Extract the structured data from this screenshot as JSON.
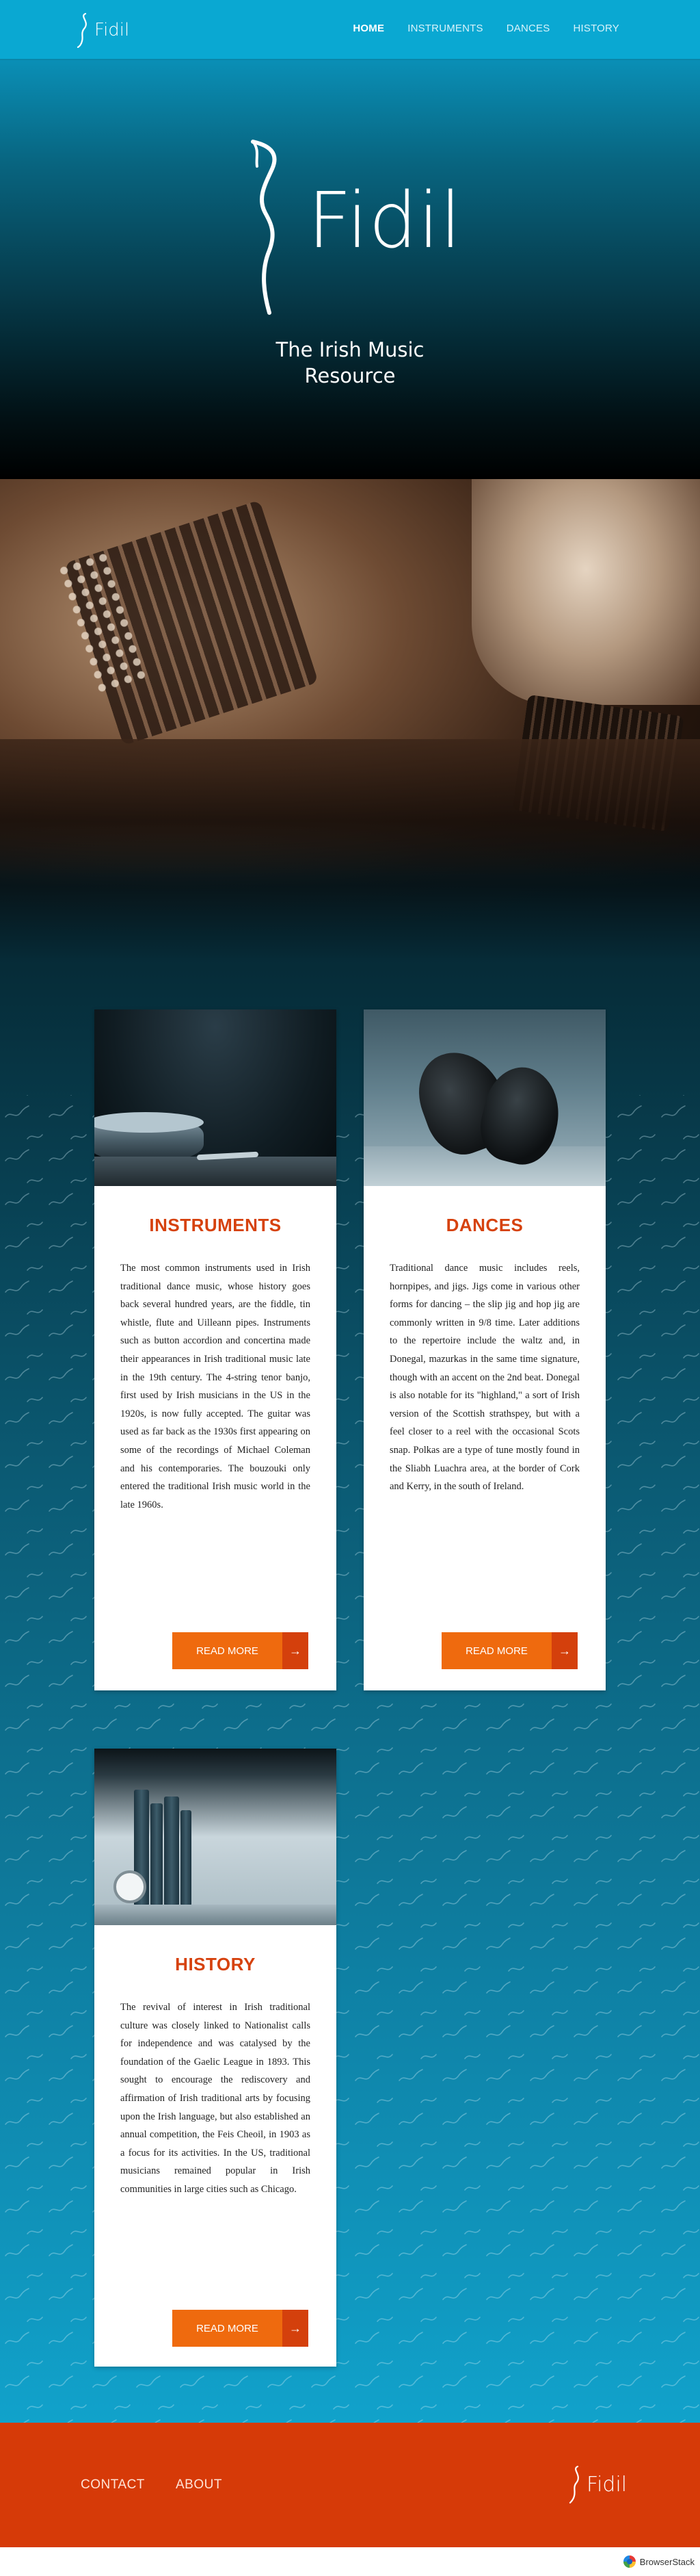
{
  "header": {
    "logo_text": "Fidil",
    "nav": [
      {
        "label": "HOME",
        "active": true
      },
      {
        "label": "INSTRUMENTS",
        "active": false
      },
      {
        "label": "DANCES",
        "active": false
      },
      {
        "label": "HISTORY",
        "active": false
      }
    ]
  },
  "hero": {
    "logo_text": "Fidil",
    "tagline_line1": "The Irish Music",
    "tagline_line2": "Resource"
  },
  "cards": {
    "instruments": {
      "title": "INSTRUMENTS",
      "text": "The most common instruments used in Irish traditional dance music, whose history goes back several hundred years, are the fiddle, tin whistle, flute and Uilleann pipes. Instruments such as button accordion and concertina made their appearances in Irish traditional music late in the 19th century. The 4-string tenor banjo, first used by Irish musicians in the US in the 1920s, is now fully accepted. The guitar was used as far back as the 1930s first appearing on some of the recordings of Michael Coleman and his contemporaries. The bouzouki only entered the traditional Irish music world in the late 1960s.",
      "button": "READ MORE"
    },
    "dances": {
      "title": "DANCES",
      "text": "Traditional dance music includes reels, hornpipes, and jigs. Jigs come in various other forms for dancing – the slip jig and hop jig are commonly written in 9/8 time. Later additions to the repertoire include the waltz and, in Donegal, mazurkas in the same time signature, though with an accent on the 2nd beat. Donegal is also notable for its \"highland,\" a sort of Irish version of the Scottish strathspey, but with a feel closer to a reel with the occasional Scots snap. Polkas are a type of tune mostly found in the Sliabh Luachra area, at the border of Cork and Kerry, in the south of Ireland.",
      "button": "READ MORE"
    },
    "history": {
      "title": "HISTORY",
      "text": "The revival of interest in Irish traditional culture was closely linked to Nationalist calls for independence and was catalysed by the foundation of the Gaelic League in 1893. This sought to encourage the rediscovery and affirmation of Irish traditional arts by focusing upon the Irish language, but also established an annual competition, the Feis Cheoil, in 1903 as a focus for its activities. In the US, traditional musicians remained popular in Irish communities in large cities such as Chicago.",
      "button": "READ MORE"
    }
  },
  "footer": {
    "links": [
      "CONTACT",
      "ABOUT"
    ],
    "logo_text": "Fidil"
  },
  "watermark": "BrowserStack",
  "colors": {
    "nav_bg": "#0aa8d2",
    "accent_orange": "#ef6a0e",
    "accent_orange_dark": "#d4400c",
    "footer_bg": "#d63a08",
    "title_red": "#d6420e"
  }
}
